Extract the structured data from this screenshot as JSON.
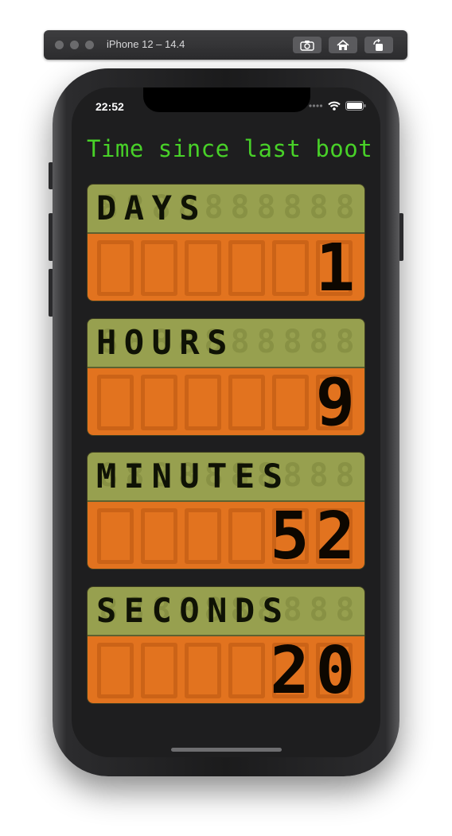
{
  "simulator": {
    "title": "iPhone 12 – 14.4",
    "buttons": [
      "screenshot",
      "home",
      "rotate"
    ]
  },
  "status_bar": {
    "time": "22:52",
    "icons": [
      "signal-dots-icon",
      "wifi-icon",
      "battery-icon"
    ]
  },
  "app": {
    "title": "Time since last boot",
    "colors": {
      "title": "#48d128",
      "label_lcd": "#97a04f",
      "value_lcd": "#e2731f",
      "background": "#1e1e1f"
    },
    "panels": [
      {
        "label": "DAYS",
        "value": "1"
      },
      {
        "label": "HOURS",
        "value": "9"
      },
      {
        "label": "MINUTES",
        "value": "52"
      },
      {
        "label": "SECONDS",
        "value": "20"
      }
    ]
  }
}
